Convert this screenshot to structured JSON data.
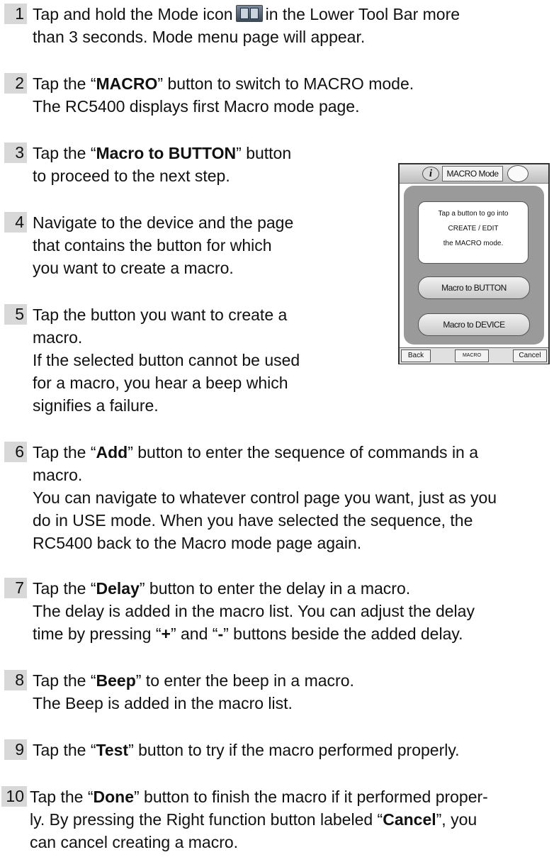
{
  "steps": [
    {
      "num": "1",
      "lines": [
        {
          "parts": [
            "Tap and hold the Mode icon",
            "in the Lower Tool Bar more"
          ]
        },
        {
          "text": "than 3 seconds. Mode menu page will appear."
        }
      ]
    },
    {
      "num": "2",
      "l1": [
        "Tap the “",
        "MACRO",
        "” button to switch to MACRO mode."
      ],
      "l2": "The RC5400 displays first Macro mode page."
    },
    {
      "num": "3",
      "l1": [
        "Tap the “",
        "Macro to BUTTON",
        "” button"
      ],
      "l2": "to proceed to the next step."
    },
    {
      "num": "4",
      "lines": [
        "Navigate to the device and the page",
        "that contains the button for which",
        "you want  to create a macro."
      ]
    },
    {
      "num": "5",
      "lines": [
        "Tap the button you want to create a",
        "macro.",
        "If the selected button cannot be used",
        "for a macro, you hear a beep which",
        "signifies a failure."
      ]
    },
    {
      "num": "6",
      "l1": [
        "Tap the “",
        "Add",
        "” button to enter the sequence of commands in a"
      ],
      "lines": [
        "macro.",
        "You can navigate to whatever control page you want, just as you",
        "do in USE mode. When you have selected the sequence, the",
        "RC5400 back to the Macro mode page again."
      ]
    },
    {
      "num": "7",
      "l1": [
        "Tap the “",
        "Delay",
        "” button to enter the delay in a macro."
      ],
      "l2": "The delay is added in the macro list. You can adjust the delay",
      "l3": [
        "time by pressing “",
        "+",
        "” and “",
        "-",
        "” buttons beside the added delay."
      ]
    },
    {
      "num": "8",
      "l1": [
        "Tap the “",
        "Beep",
        "” to enter the beep in a macro."
      ],
      "l2": "The Beep is added in the macro list."
    },
    {
      "num": "9",
      "l1": [
        "Tap the “",
        "Test",
        "” button to try if the macro performed properly."
      ]
    },
    {
      "num": "10",
      "l1": [
        "Tap the “",
        "Done",
        "” button to finish the macro if it performed proper-"
      ],
      "l2": [
        "ly. By pressing the Right function button labeled “",
        "Cancel",
        "”, you"
      ],
      "l3": "can cancel creating a macro."
    }
  ],
  "device_screen": {
    "info_icon": "i",
    "title": "MACRO Mode",
    "message": [
      "Tap a button to go into",
      "CREATE / EDIT",
      "the MACRO mode."
    ],
    "buttons": [
      "Macro to BUTTON",
      "Macro to DEVICE"
    ],
    "softkeys": {
      "left": "Back",
      "center": "MACRO",
      "right": "Cancel"
    }
  }
}
